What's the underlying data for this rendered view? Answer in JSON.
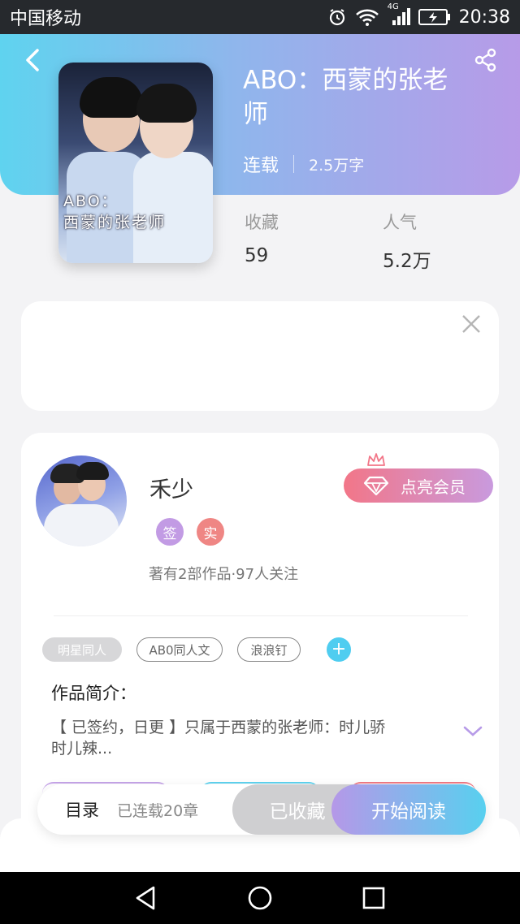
{
  "status_bar": {
    "carrier": "中国移动",
    "network": "4G",
    "time": "20:38",
    "icons": [
      "alarm-icon",
      "wifi-icon",
      "signal-icon",
      "battery-charging-icon"
    ]
  },
  "book": {
    "title": "ABO：西蒙的张老师",
    "status": "连载",
    "word_count": "2.5万字",
    "cover_text_line1": "ABO：",
    "cover_text_line2": "西蒙的张老师",
    "favorites_label": "收藏",
    "favorites_value": "59",
    "popularity_label": "人气",
    "popularity_value": "5.2万"
  },
  "author": {
    "name": "禾少",
    "badge_signed": "签",
    "badge_real": "实",
    "summary": "著有2部作品·97人关注",
    "vip_button": "点亮会员"
  },
  "tags": [
    "明星同人",
    "AB0同人文",
    "浪浪钉"
  ],
  "intro": {
    "title": "作品简介：",
    "text": "【 已签约，日更 】只属于西蒙的张老师：时儿骄时儿辣..."
  },
  "action_bar": {
    "toc_label": "目录",
    "toc_count": "已连载20章",
    "collected_label": "已收藏",
    "read_label": "开始阅读"
  },
  "colors": {
    "hero_gradient_start": "#5fd3ef",
    "hero_gradient_end": "#b79be8",
    "vip_gradient_start": "#f27688",
    "vip_gradient_end": "#c99ade",
    "tag_add": "#4fcdf0",
    "badge_signed": "#c29be4",
    "badge_real": "#ef8684"
  }
}
